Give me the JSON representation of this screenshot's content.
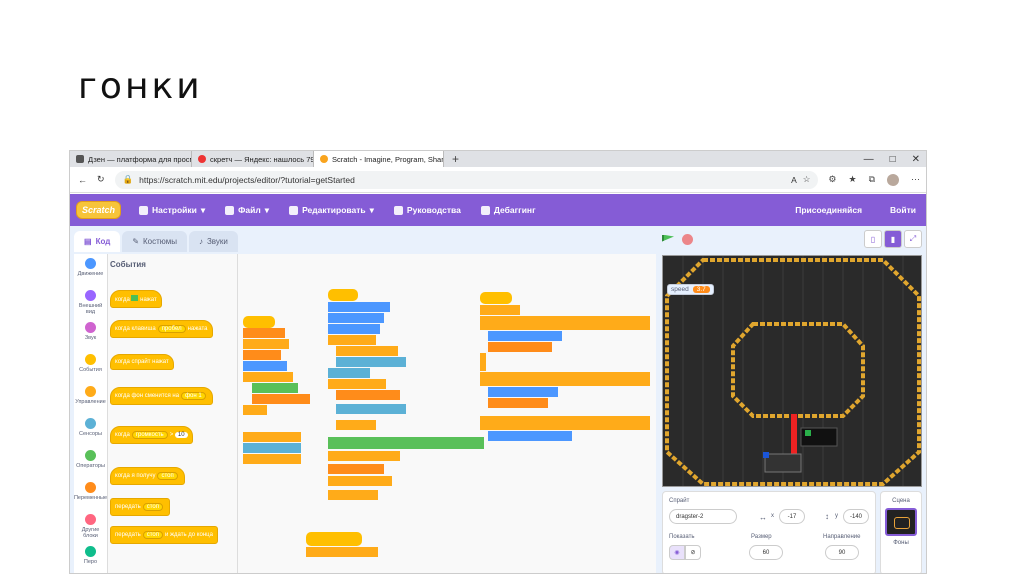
{
  "slide": {
    "title": "гонки"
  },
  "browser": {
    "tabs": [
      {
        "label": "Дзен — платформа для просмо"
      },
      {
        "label": "скретч — Яндекс: нашлось 79 т"
      },
      {
        "label": "Scratch - Imagine, Program, Shar"
      }
    ],
    "new_tab": "+",
    "url": "https://scratch.mit.edu/projects/editor/?tutorial=getStarted",
    "reader_label": "A",
    "win": {
      "min": "—",
      "max": "□",
      "close": "✕"
    }
  },
  "scratch_menu": {
    "logo": "Scratch",
    "items": [
      "Настройки",
      "Файл",
      "Редактировать",
      "Руководства",
      "Дебаггинг"
    ],
    "join": "Присоединяйся",
    "signin": "Войти"
  },
  "editor_tabs": [
    "Код",
    "Костюмы",
    "Звуки"
  ],
  "categories": [
    {
      "label": "Движение",
      "color": "#4c97ff"
    },
    {
      "label": "Внешний вид",
      "color": "#9966ff"
    },
    {
      "label": "Звук",
      "color": "#cf63cf"
    },
    {
      "label": "События",
      "color": "#ffbf00"
    },
    {
      "label": "Управление",
      "color": "#ffab19"
    },
    {
      "label": "Сенсоры",
      "color": "#5cb1d6"
    },
    {
      "label": "Операторы",
      "color": "#59c059"
    },
    {
      "label": "Переменные",
      "color": "#ff8c1a"
    },
    {
      "label": "Другие блоки",
      "color": "#ff6680"
    },
    {
      "label": "Перо",
      "color": "#0fbd8c"
    }
  ],
  "palette": {
    "heading": "События",
    "blocks": {
      "flag_pre": "когда",
      "flag_post": "нажат",
      "key_pre": "когда клавиша",
      "key_val": "пробел",
      "key_post": "нажата",
      "sprite": "когда спрайт нажат",
      "bg_pre": "когда фон сменится на",
      "bg_val": "фон 1",
      "loud_pre": "когда",
      "loud_val": "громкость",
      "loud_op": ">",
      "loud_num": "10",
      "recv_pre": "когда я получу",
      "recv_val": "стоп",
      "send_pre": "передать",
      "send_val": "стоп",
      "sendwait_pre": "передать",
      "sendwait_val": "стоп",
      "sendwait_post": "и ждать до конца"
    }
  },
  "stage": {
    "monitor_label": "speed",
    "monitor_value": "3.7"
  },
  "sprite_info": {
    "sprite_label": "Спрайт",
    "sprite_name": "dragster-2",
    "x_label": "x",
    "x": "-17",
    "y_label": "y",
    "y": "-140",
    "show_label": "Показать",
    "size_label": "Размер",
    "size": "60",
    "dir_label": "Направление",
    "dir": "90"
  },
  "scene": {
    "label": "Сцена",
    "backdrops": "Фоны"
  }
}
